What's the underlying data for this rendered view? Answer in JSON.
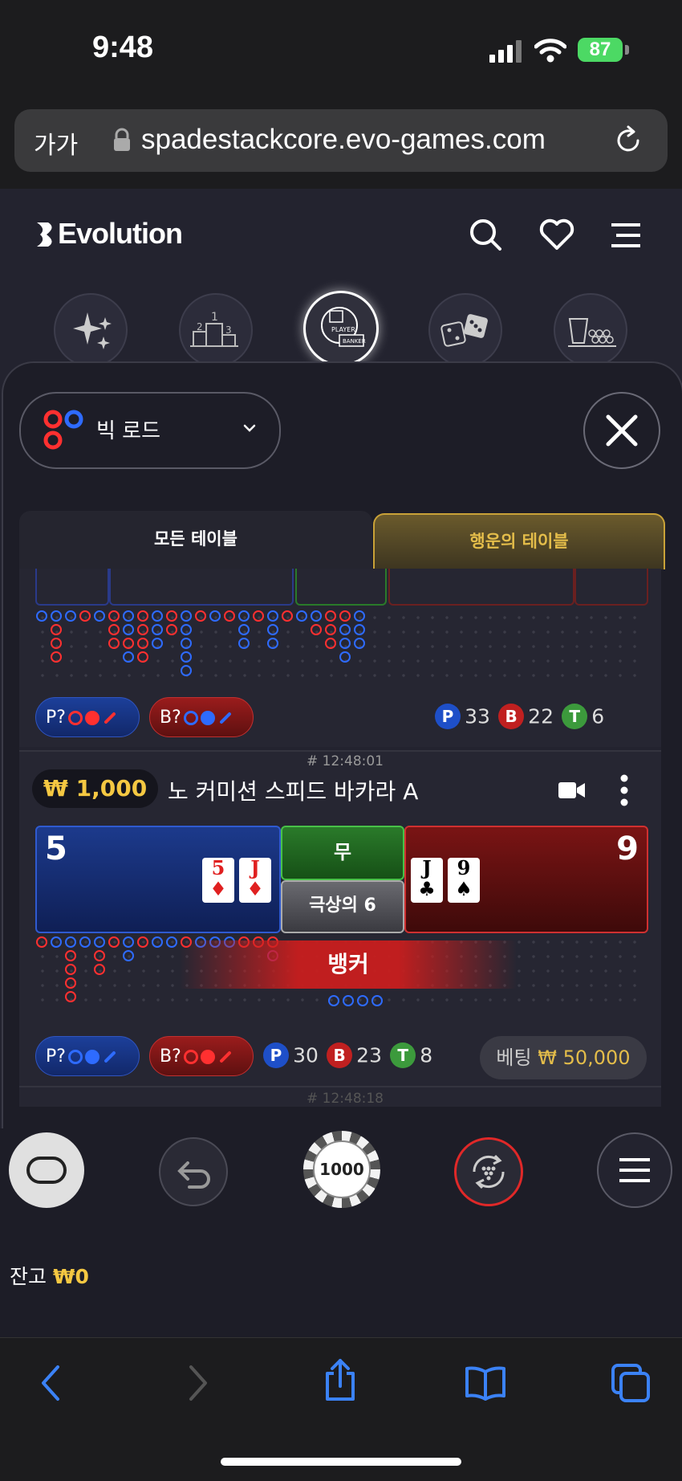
{
  "status_bar": {
    "time": "9:48",
    "battery": "87"
  },
  "browser": {
    "text_size": "가가",
    "url": "spadestackcore.evo-games.com"
  },
  "app": {
    "logo": "Evolution"
  },
  "categories": [
    {
      "icon": "sparkles-icon"
    },
    {
      "icon": "podium-icon"
    },
    {
      "icon": "baccarat-icon",
      "labels": [
        "PLAYER",
        "BANKER"
      ],
      "active": true
    },
    {
      "icon": "dice-icon"
    },
    {
      "icon": "roulette-icon"
    }
  ],
  "road_selector": {
    "label": "빅 로드"
  },
  "tabs": {
    "all": "모든 테이블",
    "lucky": "행운의 테이블"
  },
  "card1": {
    "p_pred": "P?",
    "b_pred": "B?",
    "stats": {
      "p_label": "P",
      "p": "33",
      "b_label": "B",
      "b": "22",
      "t_label": "T",
      "t": "6"
    }
  },
  "card2": {
    "timestamp": "# 12:48:01",
    "min_bet": "₩ 1,000",
    "table_name": "노 커미션 스피드 바카라 A",
    "player_score": "5",
    "banker_score": "9",
    "tie_label": "무",
    "super6_label": "극상의 6",
    "player_cards": [
      {
        "rank": "5",
        "suit": "♦"
      },
      {
        "rank": "J",
        "suit": "♦"
      }
    ],
    "banker_cards": [
      {
        "rank": "J",
        "suit": "♣"
      },
      {
        "rank": "9",
        "suit": "♠"
      }
    ],
    "winner": "뱅커",
    "p_pred": "P?",
    "b_pred": "B?",
    "stats": {
      "p_label": "P",
      "p": "30",
      "b_label": "B",
      "b": "23",
      "t_label": "T",
      "t": "8"
    },
    "bet_label": "베팅",
    "bet_amount": "₩ 50,000"
  },
  "card3": {
    "timestamp": "# 12:48:18"
  },
  "controls": {
    "chip": "1000"
  },
  "balance": {
    "label": "잔고",
    "amount": "₩0"
  },
  "colors": {
    "player_blue": "#2e6bff",
    "banker_red": "#ff3030",
    "tie_green": "#3c9a3c",
    "gold": "#e4bd4a"
  }
}
